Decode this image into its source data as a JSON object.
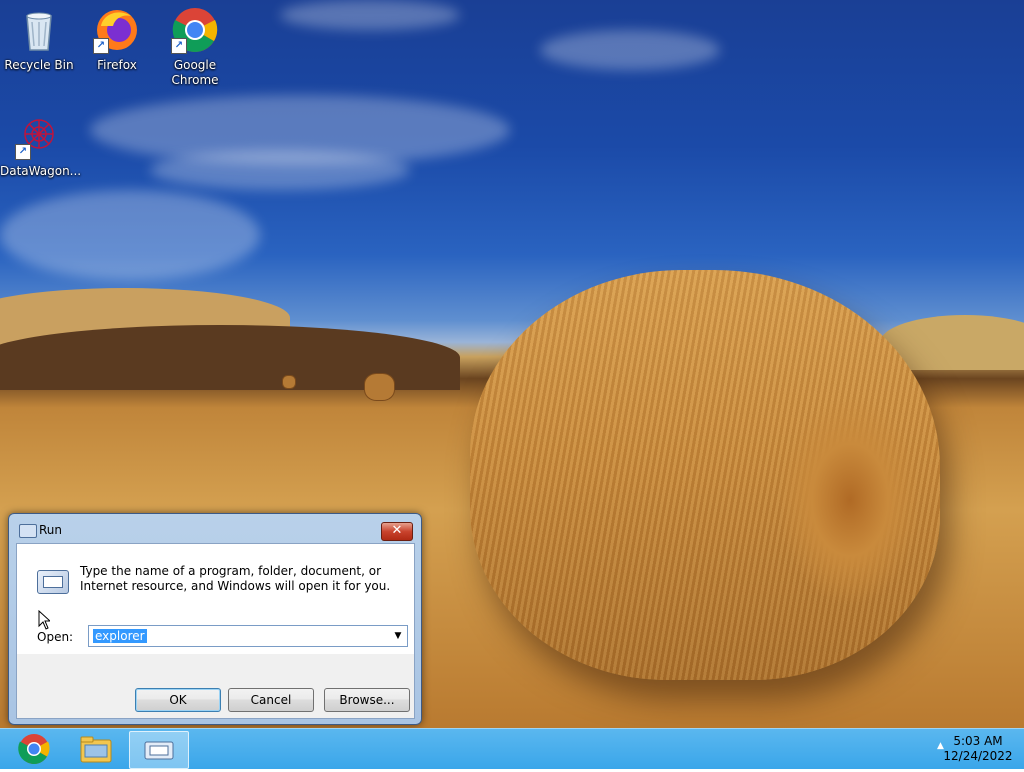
{
  "desktop": {
    "icons": [
      {
        "label": "Recycle Bin",
        "icon": "recycle-bin-icon"
      },
      {
        "label": "Firefox",
        "icon": "firefox-icon"
      },
      {
        "label": "Google Chrome",
        "icon": "chrome-icon"
      },
      {
        "label": "DataWagon...",
        "icon": "datawagon-icon"
      }
    ]
  },
  "run_dialog": {
    "title": "Run",
    "close_symbol": "✕",
    "description": "Type the name of a program, folder, document, or Internet resource, and Windows will open it for you.",
    "open_label": "Open:",
    "open_value": "explorer",
    "dropdown_symbol": "▼",
    "ok_label": "OK",
    "cancel_label": "Cancel",
    "browse_label": "Browse..."
  },
  "taskbar": {
    "buttons": [
      {
        "icon": "chrome-icon"
      },
      {
        "icon": "file-explorer-icon"
      },
      {
        "icon": "run-icon",
        "active": true
      }
    ],
    "tray_arrow": "▲",
    "time": "5:03 AM",
    "date": "12/24/2022"
  },
  "colors": {
    "taskbar": "#3aa6ea",
    "selection": "#3399ff",
    "close_button": "#c9432d"
  }
}
